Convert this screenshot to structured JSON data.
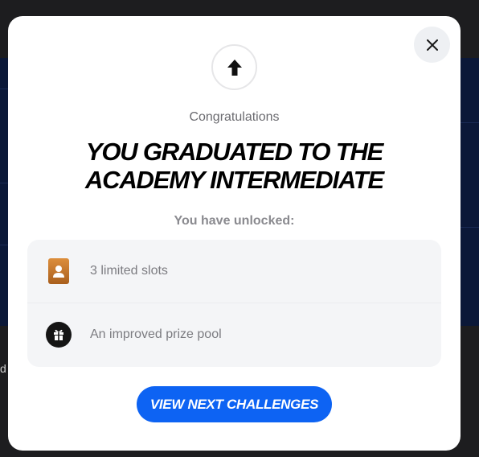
{
  "background": {
    "edge_letter": "d"
  },
  "modal": {
    "close_icon": "close-icon",
    "badge_icon": "arrow-up-icon",
    "subtitle": "Congratulations",
    "title": "YOU GRADUATED TO THE ACADEMY INTERMEDIATE",
    "unlock_label": "You have unlocked:",
    "items": [
      {
        "icon": "card-slot-icon",
        "label": "3 limited slots"
      },
      {
        "icon": "gift-icon",
        "label": "An improved prize pool"
      }
    ],
    "cta_label": "VIEW NEXT CHALLENGES",
    "colors": {
      "cta": "#0d63f3",
      "slot_card": "#c2742a",
      "gift_circle": "#151515"
    }
  }
}
